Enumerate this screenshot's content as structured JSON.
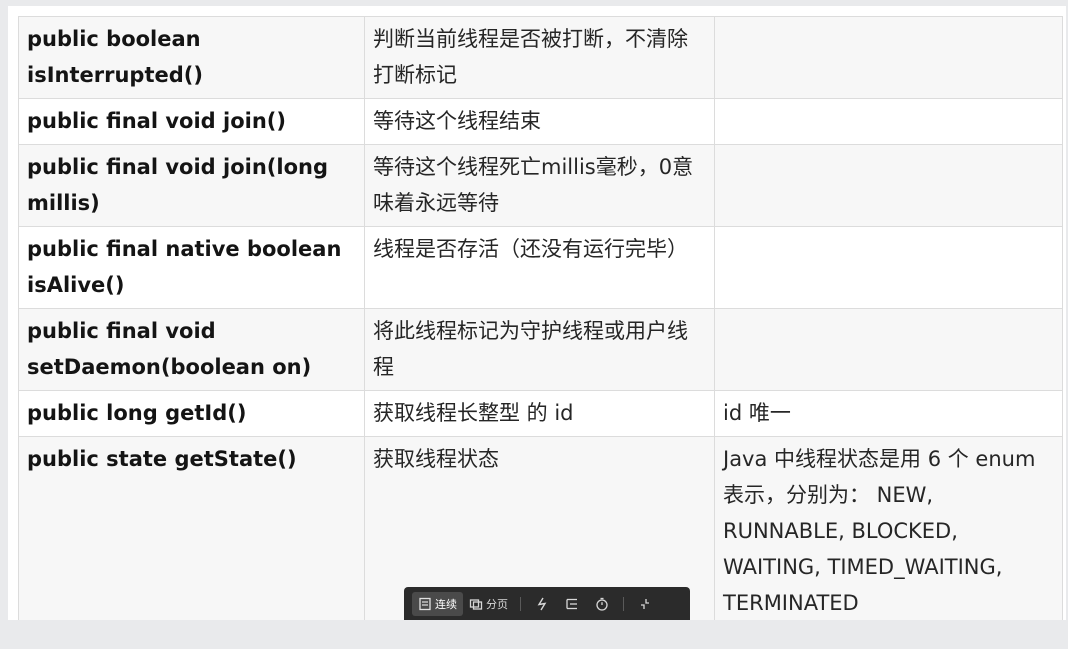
{
  "table": {
    "rows": [
      {
        "signature": "public boolean isInterrupted()",
        "description": "判断当前线程是否被打断，不清除打断标记",
        "note": ""
      },
      {
        "signature": "public final void join()",
        "description": "等待这个线程结束",
        "note": ""
      },
      {
        "signature": "public final void join(long millis)",
        "description": "等待这个线程死亡millis毫秒，0意味着永远等待",
        "note": ""
      },
      {
        "signature": "public final native boolean isAlive()",
        "description": "线程是否存活（还没有运行完毕）",
        "note": ""
      },
      {
        "signature": "public final void setDaemon(boolean on)",
        "description": "将此线程标记为守护线程或用户线程",
        "note": ""
      },
      {
        "signature": "public long getId()",
        "description": "获取线程长整型 的 id",
        "note": "id 唯一"
      },
      {
        "signature": "public state getState()",
        "description": "获取线程状态",
        "note": "Java 中线程状态是用 6 个 enum 表示，分别为： NEW, RUNNABLE, BLOCKED, WAITING, TIMED_WAITING, TERMINATED"
      }
    ]
  },
  "toolbar": {
    "continuous_label": "连续",
    "paged_label": "分页",
    "icons": [
      "continuous-icon",
      "paged-icon",
      "flash-icon",
      "outline-icon",
      "timer-icon",
      "collapse-icon"
    ]
  },
  "colors": {
    "page_bg": "#e9eaec",
    "row_shade": "#f7f7f7",
    "border": "#dcdcdc",
    "toolbar_bg": "#2b2b2b"
  }
}
